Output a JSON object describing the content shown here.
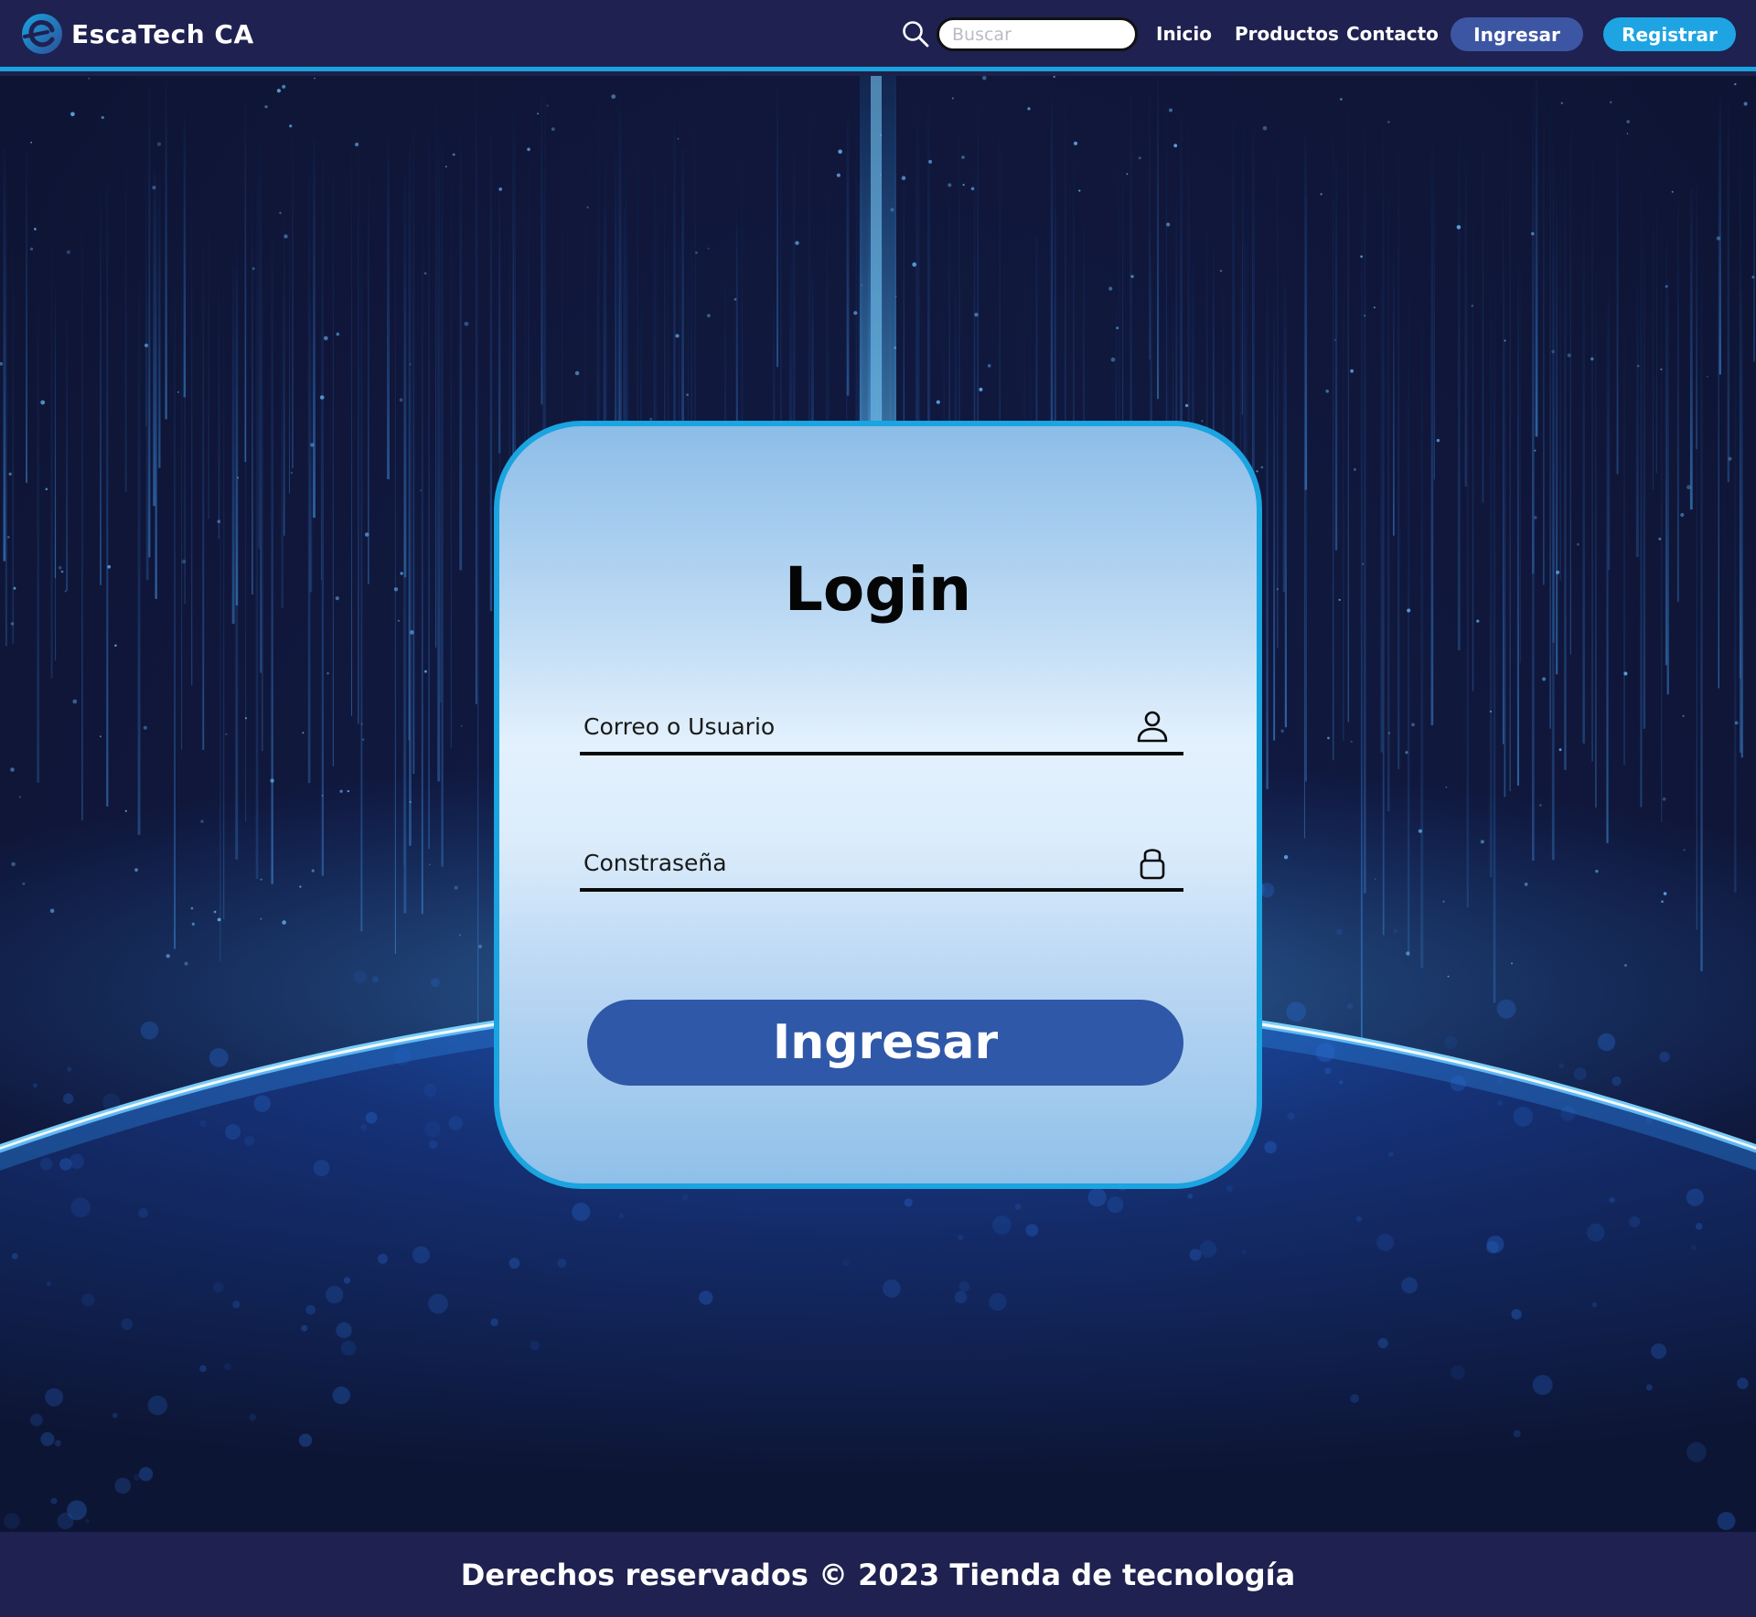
{
  "navbar": {
    "brand_name": "EscaTech CA",
    "search_placeholder": "Buscar",
    "links": [
      "Inicio",
      "Productos",
      "Contacto"
    ],
    "login_button": "Ingresar",
    "register_button": "Registrar"
  },
  "login": {
    "title": "Login",
    "user_placeholder": "Correo o Usuario",
    "password_placeholder": "Constraseña",
    "submit_label": "Ingresar"
  },
  "footer": {
    "text": "Derechos reservados © 2023 Tienda de tecnología"
  },
  "icons": {
    "search": "search-icon",
    "user": "user-icon",
    "lock": "lock-icon",
    "logo": "escatech-logo-icon"
  },
  "colors": {
    "navbar_bg": "#1f2150",
    "accent_cyan": "#1aa4e0",
    "login_button": "#3d56a4",
    "register_button": "#1ea4e3",
    "submit_button": "#2f58a8",
    "card_border": "#1aa4e0"
  }
}
